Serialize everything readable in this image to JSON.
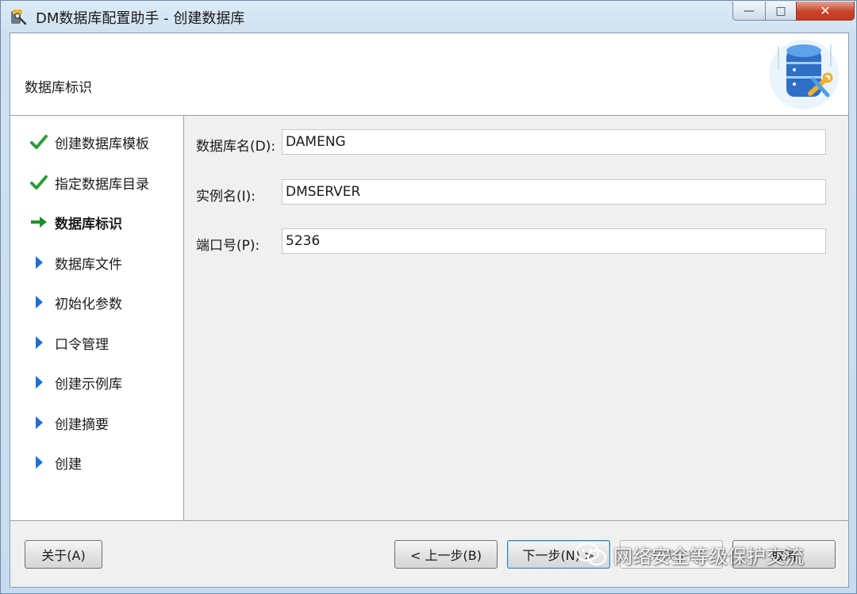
{
  "window": {
    "title": "DM数据库配置助手 - 创建数据库",
    "minimize_glyph": "—",
    "maximize_glyph": "□",
    "close_glyph": "✕"
  },
  "header": {
    "title": "数据库标识"
  },
  "steps": [
    {
      "label": "创建数据库模板",
      "state": "done",
      "icon": "checkmark-icon"
    },
    {
      "label": "指定数据库目录",
      "state": "done",
      "icon": "checkmark-icon"
    },
    {
      "label": "数据库标识",
      "state": "current",
      "icon": "arrow-right-icon"
    },
    {
      "label": "数据库文件",
      "state": "pending",
      "icon": "triangle-right-icon"
    },
    {
      "label": "初始化参数",
      "state": "pending",
      "icon": "triangle-right-icon"
    },
    {
      "label": "口令管理",
      "state": "pending",
      "icon": "triangle-right-icon"
    },
    {
      "label": "创建示例库",
      "state": "pending",
      "icon": "triangle-right-icon"
    },
    {
      "label": "创建摘要",
      "state": "pending",
      "icon": "triangle-right-icon"
    },
    {
      "label": "创建",
      "state": "pending",
      "icon": "triangle-right-icon"
    }
  ],
  "form": {
    "db_name": {
      "label": "数据库名(D):",
      "value": "DAMENG"
    },
    "instance_name": {
      "label": "实例名(I):",
      "value": "DMSERVER"
    },
    "port": {
      "label": "端口号(P):",
      "value": "5236"
    }
  },
  "buttons": {
    "about": "关于(A)",
    "prev": "< 上一步(B)",
    "next": "下一步(N) >",
    "finish": "完成(F)",
    "cancel": "取消"
  },
  "watermark": {
    "text": "网络安全等级保护交流"
  },
  "colors": {
    "check_green": "#2e9b3a",
    "arrow_green": "#1f8f2c",
    "pending_blue": "#1f6fd1",
    "titlebar": "#cfe1f1",
    "close_red": "#c8432a"
  }
}
